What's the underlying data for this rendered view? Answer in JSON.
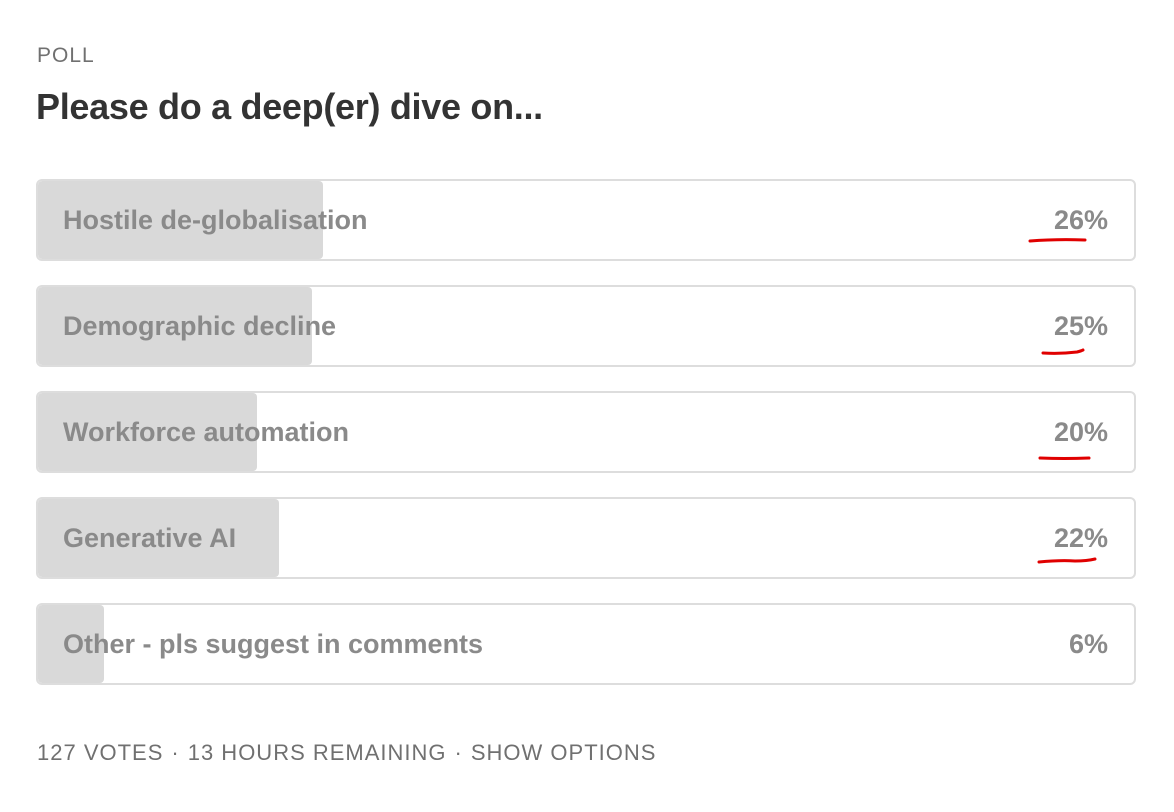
{
  "poll": {
    "label": "POLL",
    "title": "Please do a deep(er) dive on...",
    "options": [
      {
        "label": "Hostile de-globalisation",
        "percent_text": "26%",
        "percent": 26
      },
      {
        "label": "Demographic decline",
        "percent_text": "25%",
        "percent": 25
      },
      {
        "label": "Workforce automation",
        "percent_text": "20%",
        "percent": 20
      },
      {
        "label": "Generative AI",
        "percent_text": "22%",
        "percent": 22
      },
      {
        "label": "Other - pls suggest in comments",
        "percent_text": "6%",
        "percent": 6
      }
    ],
    "footer": {
      "votes": "127 VOTES",
      "remaining": "13 HOURS REMAINING",
      "show_options": "SHOW OPTIONS",
      "separator": "·"
    }
  },
  "annotations": {
    "underline_color": "#e00000",
    "underlined_options": [
      0,
      1,
      2,
      3
    ]
  },
  "colors": {
    "fill": "#d9d9d9",
    "border": "#dddddd",
    "option_text": "#8a8a8a",
    "title": "#333333",
    "meta_text": "#707070"
  }
}
